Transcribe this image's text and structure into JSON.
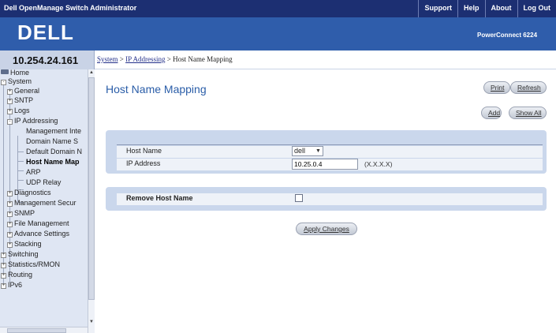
{
  "header": {
    "app_title": "Dell OpenManage Switch Administrator",
    "links": [
      "Support",
      "Help",
      "About",
      "Log Out"
    ],
    "logo": "DELL",
    "product": "PowerConnect 6224"
  },
  "device_ip": "10.254.24.161",
  "breadcrumb": {
    "items": [
      "System",
      "IP Addressing"
    ],
    "separator": ">",
    "current": "Host Name Mapping"
  },
  "tree": {
    "items": [
      {
        "label": "Home",
        "icon": "home-icon"
      },
      {
        "label": "System",
        "expander": "-"
      },
      {
        "label": "General",
        "expander": "+"
      },
      {
        "label": "SNTP",
        "expander": "+"
      },
      {
        "label": "Logs",
        "expander": "+"
      },
      {
        "label": "IP Addressing",
        "expander": "-"
      },
      {
        "label": "Management Inte"
      },
      {
        "label": "Domain Name S"
      },
      {
        "label": "Default Domain N"
      },
      {
        "label": "Host Name Map"
      },
      {
        "label": "ARP"
      },
      {
        "label": "UDP Relay"
      },
      {
        "label": "Diagnostics",
        "expander": "+"
      },
      {
        "label": "Management Secur",
        "expander": "+"
      },
      {
        "label": "SNMP",
        "expander": "+"
      },
      {
        "label": "File Management",
        "expander": "+"
      },
      {
        "label": "Advance Settings",
        "expander": "+"
      },
      {
        "label": "Stacking",
        "expander": "+"
      },
      {
        "label": "Switching",
        "expander": "+"
      },
      {
        "label": "Statistics/RMON",
        "expander": "+"
      },
      {
        "label": "Routing",
        "expander": "+"
      },
      {
        "label": "IPv6",
        "expander": "+"
      }
    ]
  },
  "page": {
    "title": "Host Name Mapping",
    "buttons": {
      "print": "Print",
      "refresh": "Refresh",
      "add": "Add",
      "show_all": "Show All",
      "apply": "Apply Changes"
    }
  },
  "form": {
    "host_name_label": "Host Name",
    "host_name_value": "dell",
    "ip_label": "IP Address",
    "ip_value": "10.25.0.4",
    "ip_hint": "(X.X.X.X)",
    "remove_label": "Remove Host Name",
    "remove_checked": false
  }
}
